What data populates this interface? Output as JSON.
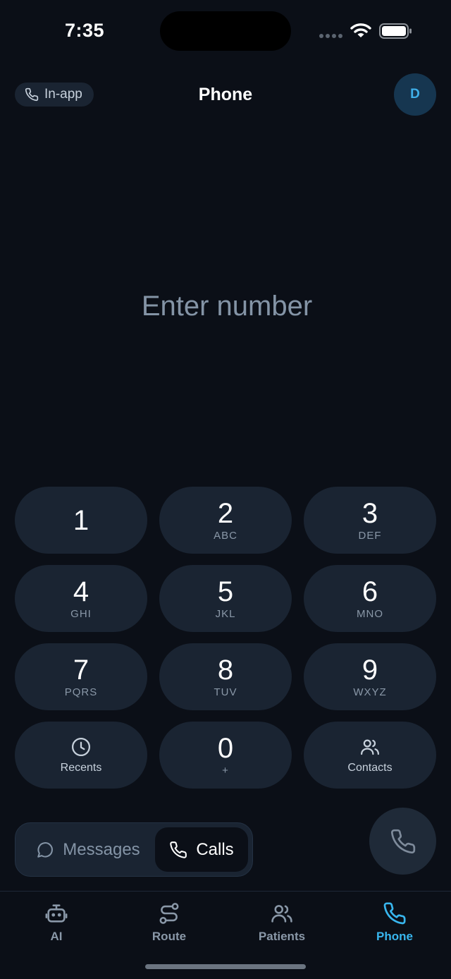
{
  "status_bar": {
    "time": "7:35"
  },
  "header": {
    "mode_chip": "In-app",
    "title": "Phone",
    "avatar_initial": "D"
  },
  "dialer": {
    "placeholder": "Enter number",
    "value": ""
  },
  "keypad": {
    "keys": [
      {
        "digit": "1",
        "letters": ""
      },
      {
        "digit": "2",
        "letters": "ABC"
      },
      {
        "digit": "3",
        "letters": "DEF"
      },
      {
        "digit": "4",
        "letters": "GHI"
      },
      {
        "digit": "5",
        "letters": "JKL"
      },
      {
        "digit": "6",
        "letters": "MNO"
      },
      {
        "digit": "7",
        "letters": "PQRS"
      },
      {
        "digit": "8",
        "letters": "TUV"
      },
      {
        "digit": "9",
        "letters": "WXYZ"
      }
    ],
    "recents_label": "Recents",
    "zero": {
      "digit": "0",
      "letters": "+"
    },
    "contacts_label": "Contacts"
  },
  "mode_toggle": {
    "messages_label": "Messages",
    "calls_label": "Calls",
    "selected": "Calls"
  },
  "tab_bar": {
    "items": [
      {
        "label": "AI",
        "icon": "robot-icon"
      },
      {
        "label": "Route",
        "icon": "route-icon"
      },
      {
        "label": "Patients",
        "icon": "users-icon"
      },
      {
        "label": "Phone",
        "icon": "phone-icon"
      }
    ],
    "active": "Phone"
  },
  "colors": {
    "background": "#0b0f17",
    "surface": "#1a2432",
    "accent": "#38b6ee",
    "muted_text": "#8494a6"
  }
}
